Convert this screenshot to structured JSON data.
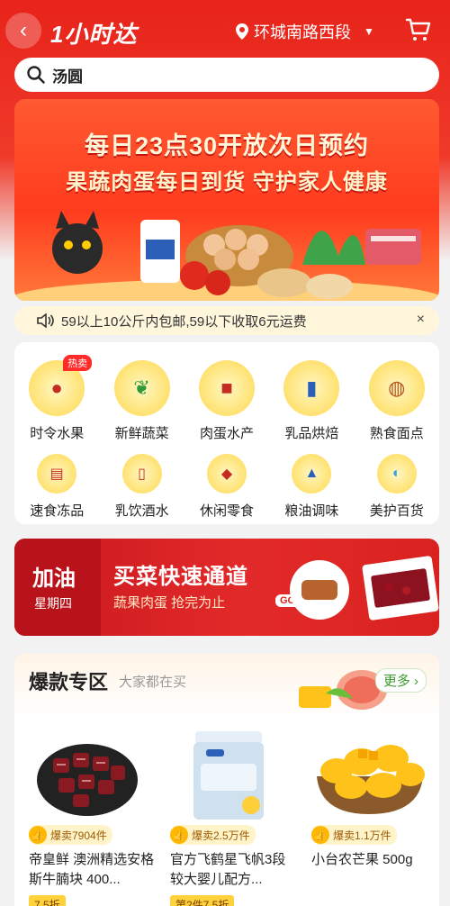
{
  "header": {
    "logo": "1小时达",
    "location": "环城南路西段",
    "back_glyph": "‹"
  },
  "search": {
    "value": "汤圆"
  },
  "hero": {
    "line1": "每日23点30开放次日预约",
    "line2": "果蔬肉蛋每日到货 守护家人健康"
  },
  "notice": {
    "text": "59以上10公斤内包邮,59以下收取6元运费",
    "close_glyph": "×"
  },
  "categories": {
    "hot_tag": "热卖",
    "row1": [
      {
        "label": "时令水果",
        "icon": "cherry-icon",
        "glyph": "●"
      },
      {
        "label": "新鲜蔬菜",
        "icon": "greens-icon",
        "glyph": "❦"
      },
      {
        "label": "肉蛋水产",
        "icon": "meat-icon",
        "glyph": "■"
      },
      {
        "label": "乳品烘焙",
        "icon": "milk-icon",
        "glyph": "▮"
      },
      {
        "label": "熟食面点",
        "icon": "food-icon",
        "glyph": "◍"
      }
    ],
    "row2": [
      {
        "label": "速食冻品",
        "icon": "noodle-icon",
        "glyph": "▤"
      },
      {
        "label": "乳饮酒水",
        "icon": "drink-icon",
        "glyph": "▯"
      },
      {
        "label": "休闲零食",
        "icon": "snack-icon",
        "glyph": "◆"
      },
      {
        "label": "粮油调味",
        "icon": "oil-icon",
        "glyph": "▲"
      },
      {
        "label": "美护百货",
        "icon": "mask-icon",
        "glyph": "◐"
      }
    ]
  },
  "promo": {
    "left_title": "加油",
    "left_day": "星期四",
    "title": "买菜快速通道",
    "subtitle": "蔬果肉蛋 抢完为止",
    "go": "GO>"
  },
  "hot": {
    "title": "爆款专区",
    "subtitle": "大家都在买",
    "more": "更多 ›",
    "products": [
      {
        "name": "帝皇鲜 澳洲精选安格斯牛腩块 400...",
        "badge": "爆卖7904件",
        "tag": "7.5折",
        "icon": "beef-icon"
      },
      {
        "name": "官方飞鹤星飞帆3段较大婴儿配方...",
        "badge": "爆卖2.5万件",
        "tag": "第2件7.5折",
        "icon": "formula-can-icon"
      },
      {
        "name": "小台农芒果 500g",
        "badge": "爆卖1.1万件",
        "tag": "",
        "icon": "mango-icon"
      }
    ]
  },
  "colors": {
    "brand_red": "#e8231a",
    "accent_yellow": "#ffd84d"
  }
}
